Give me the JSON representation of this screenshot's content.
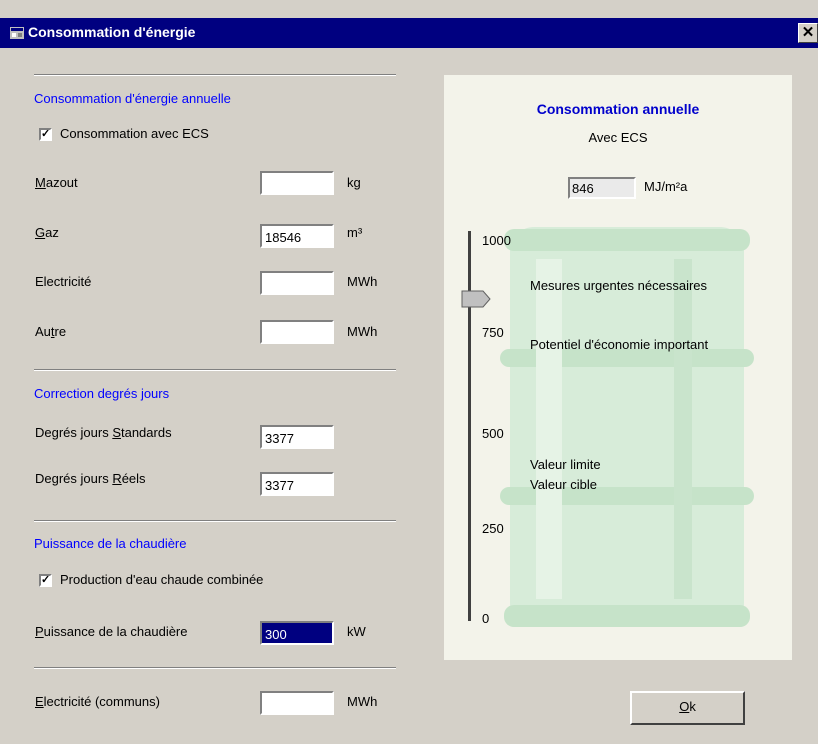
{
  "window": {
    "title": "Consommation d'énergie",
    "close_glyph": "✕"
  },
  "section_annual": {
    "heading": "Consommation d'énergie annuelle",
    "checkbox": {
      "label": "Consommation avec ECS",
      "checked": true
    },
    "mazout": {
      "label_first": "M",
      "label_rest": "azout",
      "value": "",
      "unit": "kg"
    },
    "gaz": {
      "label_first": "G",
      "label_rest": "az",
      "value": "18546",
      "unit": "m³"
    },
    "electricite": {
      "label": "Electricité",
      "value": "",
      "unit": "MWh"
    },
    "autre": {
      "label_pre": "Au",
      "label_u": "t",
      "label_post": "re",
      "value": "",
      "unit": "MWh"
    }
  },
  "section_degree": {
    "heading": "Correction degrés jours",
    "standards": {
      "label_pre": "Degrés jours ",
      "label_u": "S",
      "label_post": "tandards",
      "value": "3377"
    },
    "reels": {
      "label_pre": "Degrés jours ",
      "label_u": "R",
      "label_post": "éels",
      "value": "3377"
    }
  },
  "section_boiler": {
    "heading": "Puissance de la chaudière",
    "checkbox": {
      "label": "Production d'eau chaude combinée",
      "checked": true
    },
    "power": {
      "label_first": "P",
      "label_rest": "uissance de la chaudière",
      "value": "300",
      "unit": "kW"
    }
  },
  "common_elec": {
    "label_first": "E",
    "label_rest": "lectricité (communs)",
    "value": "",
    "unit": "MWh"
  },
  "gauge": {
    "title": "Consommation annuelle",
    "subtitle": "Avec ECS",
    "value": "846",
    "unit": "MJ/m²a",
    "ticks": [
      "1000",
      "750",
      "500",
      "250",
      "0"
    ],
    "zones": {
      "urgent": "Mesures urgentes nécessaires",
      "potential": "Potentiel d'économie important",
      "limit": "Valeur limite",
      "target": "Valeur cible"
    },
    "scale_max": 1000
  },
  "ok_button": {
    "label_first": "O",
    "label_rest": "k"
  },
  "colors": {
    "titlebar": "#000080",
    "section": "#0000ff",
    "gauge_title": "#0000cc",
    "face": "#d4d0c8"
  },
  "icons": {
    "app": "app-icon",
    "close": "close-icon",
    "pointer": "gauge-pointer-icon",
    "barrel": "barrel-icon"
  }
}
